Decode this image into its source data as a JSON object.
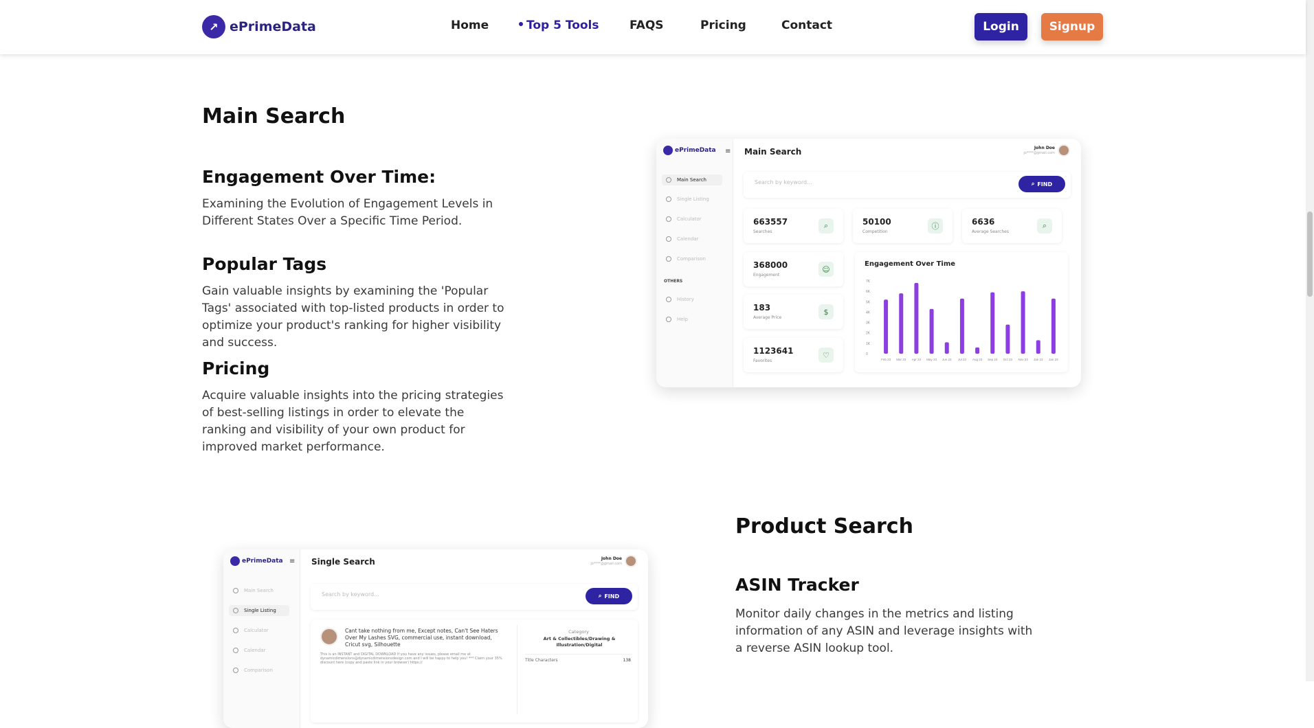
{
  "nav": {
    "brand": "ePrimeData",
    "links": [
      "Home",
      "Top 5 Tools",
      "FAQS",
      "Pricing",
      "Contact"
    ],
    "login": "Login",
    "signup": "Signup"
  },
  "section1": {
    "title": "Main Search",
    "features": [
      {
        "heading": "Engagement Over Time:",
        "text": "Examining the Evolution of Engagement Levels in Different States Over a Specific Time Period."
      },
      {
        "heading": "Popular Tags",
        "text": "Gain valuable insights by examining the 'Popular Tags' associated with top-listed products in order to optimize your product's ranking for higher visibility and success."
      },
      {
        "heading": "Pricing",
        "text": "Acquire valuable insights into the pricing strategies of best-selling listings in order to elevate the ranking and visibility of your own product for improved market performance."
      }
    ]
  },
  "section2": {
    "title": "Product Search",
    "features": [
      {
        "heading": "ASIN Tracker",
        "text": "Monitor daily changes in the metrics and listing information of any ASIN and leverage insights with a reverse ASIN lookup tool."
      }
    ]
  },
  "mock1": {
    "brand": "ePrimeData",
    "title": "Main Search",
    "user_name": "John Doe",
    "user_email": "jo****@gmail.com",
    "search_placeholder": "Search by keyword...",
    "find": "FIND",
    "sidebar": [
      "Main Search",
      "Single Listing",
      "Calculator",
      "Calendar",
      "Comparison"
    ],
    "others_label": "OTHERS",
    "others": [
      "History",
      "Help"
    ],
    "stats": [
      {
        "value": "663557",
        "label": "Searches",
        "icon": "search-icon"
      },
      {
        "value": "50100",
        "label": "Competition",
        "icon": "info-icon"
      },
      {
        "value": "6636",
        "label": "Average Searches",
        "icon": "search-icon"
      },
      {
        "value": "368000",
        "label": "Engagement",
        "icon": "users-icon"
      },
      {
        "value": "183",
        "label": "Average Price",
        "icon": "dollar-icon"
      },
      {
        "value": "1123641",
        "label": "Favorites",
        "icon": "heart-icon"
      }
    ],
    "chart_title": "Engagement Over Time"
  },
  "mock2": {
    "brand": "ePrimeData",
    "title": "Single Search",
    "user_name": "John Doe",
    "user_email": "jo****@gmail.com",
    "search_placeholder": "Search by keyword...",
    "find": "FIND",
    "sidebar": [
      "Main Search",
      "Single Listing",
      "Calculator",
      "Calendar",
      "Comparison"
    ],
    "listing_title": "Cant take nothing from me, Except notes, Can't See Haters Over My Lashes SVG, commercial use, instant download, Cricut svg, Silhouette",
    "listing_desc": "This is an INSTANT and DIGITAL DOWNLOAD If you have any issues, please email me at dynamicdimensions@dynamicdimensionsdesign.com and I will be happy to help you! *** Claim your 35% discount here (copy and paste link in your browser) https://",
    "category_label": "Category",
    "category_value": "Art & Collectibles/Drawing & Illustration/Digital",
    "title_chars_label": "Title Characters",
    "title_chars_value": "138"
  },
  "chart_data": {
    "type": "bar",
    "title": "Engagement Over Time",
    "categories": [
      "Feb 23",
      "Mar 23",
      "Apr 23",
      "May 23",
      "Jun 23",
      "Jul 23",
      "Aug 23",
      "Sep 23",
      "Oct 23",
      "Nov 23",
      "Jan 23",
      "Jan 23"
    ],
    "values": [
      5200,
      5800,
      6800,
      4300,
      1100,
      5300,
      600,
      5900,
      2800,
      6000,
      1300,
      5300
    ],
    "y_ticks": [
      "7K",
      "6K",
      "5K",
      "4K",
      "3K",
      "2K",
      "1K",
      "0"
    ],
    "ylim": [
      0,
      7000
    ],
    "bar_color": "#8b3fe0"
  }
}
